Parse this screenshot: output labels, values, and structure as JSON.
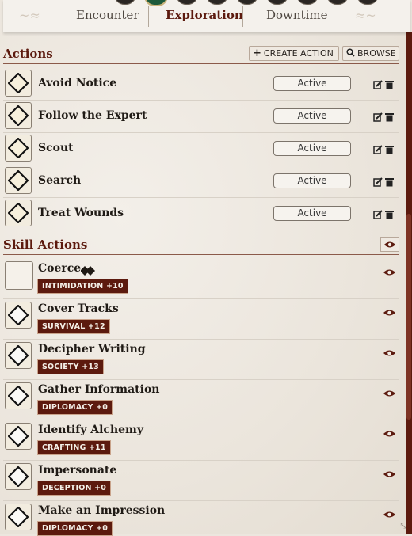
{
  "tabs": [
    "Encounter",
    "Exploration",
    "Downtime"
  ],
  "actions_section": {
    "title": "Actions",
    "create_label": "CREATE ACTION",
    "browse_label": "BROWSE"
  },
  "actions": [
    {
      "name": "Avoid Notice",
      "status": "Active"
    },
    {
      "name": "Follow the Expert",
      "status": "Active"
    },
    {
      "name": "Scout",
      "status": "Active"
    },
    {
      "name": "Search",
      "status": "Active"
    },
    {
      "name": "Treat Wounds",
      "status": "Active"
    }
  ],
  "skill_section": {
    "title": "Skill Actions"
  },
  "skill_actions": [
    {
      "name": "Coerce",
      "badge": "INTIMIDATION +10"
    },
    {
      "name": "Cover Tracks",
      "badge": "SURVIVAL +12"
    },
    {
      "name": "Decipher Writing",
      "badge": "SOCIETY +13"
    },
    {
      "name": "Gather Information",
      "badge": "DIPLOMACY +0"
    },
    {
      "name": "Identify Alchemy",
      "badge": "CRAFTING +11"
    },
    {
      "name": "Impersonate",
      "badge": "DECEPTION +0"
    },
    {
      "name": "Make an Impression",
      "badge": "DIPLOMACY +0"
    }
  ],
  "colors": {
    "accent": "#5c1a0e",
    "background": "#ece6de"
  }
}
